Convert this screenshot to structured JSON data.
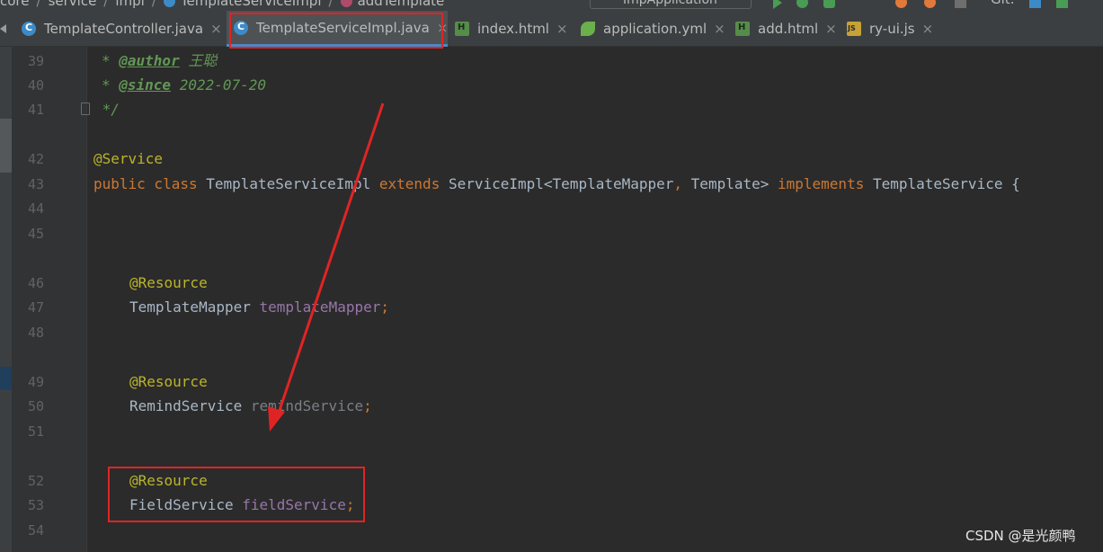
{
  "breadcrumb": {
    "items": [
      "core",
      "service",
      "impl",
      "TemplateServiceImpl",
      "addTemplate"
    ],
    "run_config": "ImpApplication",
    "git_label": "Git:"
  },
  "tabs": [
    {
      "label": "TemplateController.java",
      "icon": "java-class-icon",
      "active": false
    },
    {
      "label": "TemplateServiceImpl.java",
      "icon": "java-class-icon",
      "active": true
    },
    {
      "label": "index.html",
      "icon": "html-file-icon",
      "active": false
    },
    {
      "label": "application.yml",
      "icon": "spring-yml-icon",
      "active": false
    },
    {
      "label": "add.html",
      "icon": "html-file-icon",
      "active": false
    },
    {
      "label": "ry-ui.js",
      "icon": "js-file-icon",
      "active": false
    }
  ],
  "tab_close_glyph": "×",
  "editor": {
    "line_numbers": [
      "39",
      "40",
      "41",
      "42",
      "43",
      "44",
      "45",
      "46",
      "47",
      "48",
      "49",
      "50",
      "51",
      "52",
      "53",
      "54"
    ],
    "line39": {
      "star": "* ",
      "tag": "@author",
      "value": " 王聪"
    },
    "line40": {
      "star": "* ",
      "tag": "@since",
      "value": " 2022-07-20"
    },
    "line41": {
      "text": " */"
    },
    "line42": {
      "annotation": "@Service"
    },
    "line43": {
      "kw1": "public class ",
      "name": "TemplateServiceImpl ",
      "kw2": "extends ",
      "parent": "ServiceImpl<TemplateMapper",
      "comma": ", ",
      "parent2": "Template> ",
      "kw3": "implements ",
      "iface": "TemplateService {"
    },
    "line46": {
      "annotation": "@Resource"
    },
    "line47": {
      "type": "TemplateMapper ",
      "field": "templateMapper",
      "semi": ";"
    },
    "line49": {
      "annotation": "@Resource"
    },
    "line50": {
      "type": "RemindService ",
      "field": "remindService",
      "semi": ";"
    },
    "line52": {
      "annotation": "@Resource"
    },
    "line53": {
      "type": "FieldService ",
      "field": "fieldService",
      "semi": ";"
    }
  },
  "watermark": "CSDN @是光颜鸭",
  "colors": {
    "highlight_box": "#e02424",
    "arrow": "#e02424",
    "keyword": "#cc7832",
    "annotation": "#bbb529",
    "field": "#9876aa"
  }
}
